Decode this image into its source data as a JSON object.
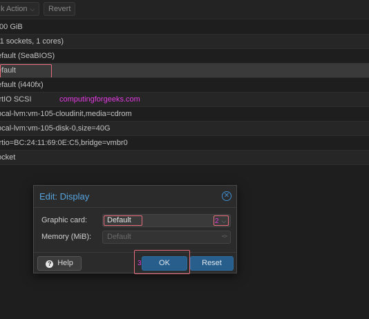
{
  "toolbar": {
    "disk_action_label": "k Action",
    "revert_label": "Revert"
  },
  "hardware_rows": [
    {
      "value": ".00 GiB"
    },
    {
      "value": " (1 sockets, 1 cores)"
    },
    {
      "value": "efault (SeaBIOS)"
    },
    {
      "value": "efault"
    },
    {
      "value": "efault (i440fx)"
    },
    {
      "value": "irtIO SCSI"
    },
    {
      "value": "ocal-lvm:vm-105-cloudinit,media=cdrom"
    },
    {
      "value": "ocal-lvm:vm-105-disk-0,size=40G"
    },
    {
      "value": "irtio=BC:24:11:69:0E:C5,bridge=vmbr0"
    },
    {
      "value": "ocket"
    }
  ],
  "watermark": "computingforgeeks.com",
  "dialog": {
    "title": "Edit: Display",
    "graphic_card_label": "Graphic card:",
    "graphic_card_value": "Default",
    "memory_label": "Memory (MiB):",
    "memory_placeholder": "Default",
    "help_label": "Help",
    "ok_label": "OK",
    "reset_label": "Reset"
  },
  "annotations": {
    "step2": "2",
    "step3": "3",
    "highlight_color": "#e86d7c",
    "number_color": "#e23be0"
  },
  "colors": {
    "accent": "#57a5e0",
    "button_primary": "#275e8b",
    "background": "#1e1e1e"
  }
}
